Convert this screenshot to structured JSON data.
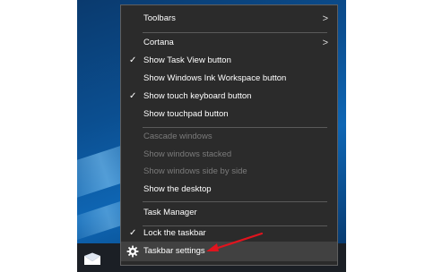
{
  "menu": {
    "items": [
      {
        "label": "Toolbars",
        "submenu": true,
        "checked": false,
        "enabled": true
      },
      {
        "label": "Cortana",
        "submenu": true,
        "checked": false,
        "enabled": true
      },
      {
        "label": "Show Task View button",
        "submenu": false,
        "checked": true,
        "enabled": true
      },
      {
        "label": "Show Windows Ink Workspace button",
        "submenu": false,
        "checked": false,
        "enabled": true
      },
      {
        "label": "Show touch keyboard button",
        "submenu": false,
        "checked": true,
        "enabled": true
      },
      {
        "label": "Show touchpad button",
        "submenu": false,
        "checked": false,
        "enabled": true
      },
      {
        "label": "Cascade windows",
        "submenu": false,
        "checked": false,
        "enabled": false
      },
      {
        "label": "Show windows stacked",
        "submenu": false,
        "checked": false,
        "enabled": false
      },
      {
        "label": "Show windows side by side",
        "submenu": false,
        "checked": false,
        "enabled": false
      },
      {
        "label": "Show the desktop",
        "submenu": false,
        "checked": false,
        "enabled": true
      },
      {
        "label": "Task Manager",
        "submenu": false,
        "checked": false,
        "enabled": true
      },
      {
        "label": "Lock the taskbar",
        "submenu": false,
        "checked": true,
        "enabled": true
      },
      {
        "label": "Taskbar settings",
        "submenu": false,
        "checked": false,
        "enabled": true,
        "icon": "gear-icon",
        "highlighted": true
      }
    ],
    "check_glyph": "✓",
    "submenu_glyph": ">"
  },
  "annotation": {
    "arrow_color": "#e0141e"
  },
  "colors": {
    "menu_bg": "#2b2b2b",
    "hover_bg": "#414141",
    "disabled_text": "#7b7b7b"
  }
}
